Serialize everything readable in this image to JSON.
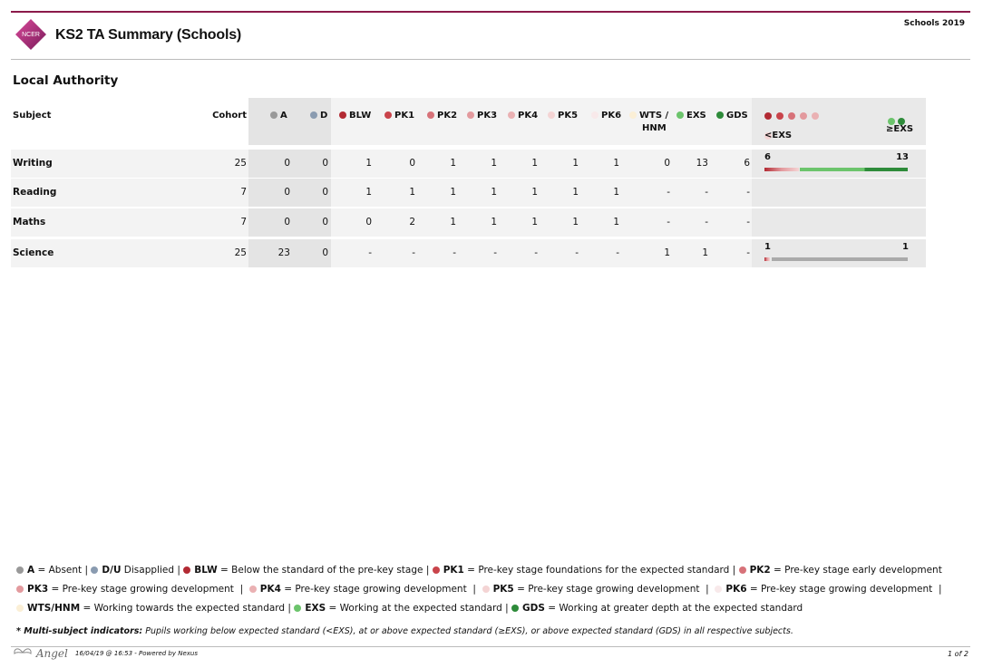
{
  "header": {
    "logo_text": "NCER",
    "title": "KS2 TA Summary (Schools)",
    "year_label": "Schools 2019"
  },
  "section_title": "Local Authority",
  "colors": {
    "A": "#999999",
    "D": "#8a9bb0",
    "BLW": "#b22a33",
    "PK1": "#c9444b",
    "PK2": "#d77279",
    "PK3": "#e39a9e",
    "PK4": "#eab1b3",
    "PK5": "#f4d4d4",
    "PK6": "#f8e9ea",
    "WTS": "#fbefd6",
    "EXS": "#6cc46c",
    "GDS": "#2e8b3a"
  },
  "columns": {
    "subject": "Subject",
    "cohort": "Cohort",
    "codes": [
      "A",
      "D",
      "BLW",
      "PK1",
      "PK2",
      "PK3",
      "PK4",
      "PK5",
      "PK6",
      "WTS /\nHNM",
      "EXS",
      "GDS"
    ],
    "wts_line1": "WTS /",
    "wts_line2": "HNM",
    "below_label": "<EXS",
    "above_label": "≥EXS"
  },
  "rows": [
    {
      "subject": "Writing",
      "cohort": "25",
      "values": [
        "0",
        "0",
        "1",
        "0",
        "1",
        "1",
        "1",
        "1",
        "1",
        "0",
        "13",
        "6"
      ],
      "below": "6",
      "above": "13",
      "below_frac": 0.24,
      "above_frac": 0.52
    },
    {
      "subject": "Reading",
      "cohort": "7",
      "values": [
        "0",
        "0",
        "1",
        "1",
        "1",
        "1",
        "1",
        "1",
        "1",
        "-",
        "-",
        "-"
      ],
      "below": "",
      "above": ""
    },
    {
      "subject": "Maths",
      "cohort": "7",
      "values": [
        "0",
        "0",
        "0",
        "2",
        "1",
        "1",
        "1",
        "1",
        "1",
        "-",
        "-",
        "-"
      ],
      "below": "",
      "above": ""
    },
    {
      "subject": "Science",
      "cohort": "25",
      "values": [
        "23",
        "0",
        "-",
        "-",
        "-",
        "-",
        "-",
        "-",
        "-",
        "1",
        "1",
        "-"
      ],
      "below": "1",
      "above": "1",
      "below_frac": 0.04,
      "above_frac": 0.04
    }
  ],
  "legend": {
    "items": [
      {
        "code": "A",
        "text": " = Absent"
      },
      {
        "code": "D/U",
        "text": " Disapplied"
      },
      {
        "code": "BLW",
        "text": " = Below the standard of the pre-key stage"
      },
      {
        "code": "PK1",
        "text": " = Pre-key stage foundations for the expected standard"
      },
      {
        "code": "PK2",
        "text": " = Pre-key stage early development"
      },
      {
        "code": "PK3",
        "text": " = Pre-key stage growing development"
      },
      {
        "code": "PK4",
        "text": " = Pre-key stage growing development"
      },
      {
        "code": "PK5",
        "text": " = Pre-key stage growing development"
      },
      {
        "code": "PK6",
        "text": " = Pre-key stage growing development"
      },
      {
        "code": "WTS/HNM",
        "text": " = Working towards the expected standard"
      },
      {
        "code": "EXS",
        "text": " = Working at the expected standard"
      },
      {
        "code": "GDS",
        "text": " = Working at greater depth at the expected standard"
      }
    ],
    "footnote_bold": "* Multi-subject indicators:",
    "footnote_text": " Pupils working below expected standard (<EXS), at or above expected standard (≥EXS), or above expected standard (GDS) in all respective subjects."
  },
  "footer": {
    "brand": "Angel",
    "stamp": "16/04/19 @ 16:53 - Powered by Nexus",
    "page": "1 of 2"
  }
}
